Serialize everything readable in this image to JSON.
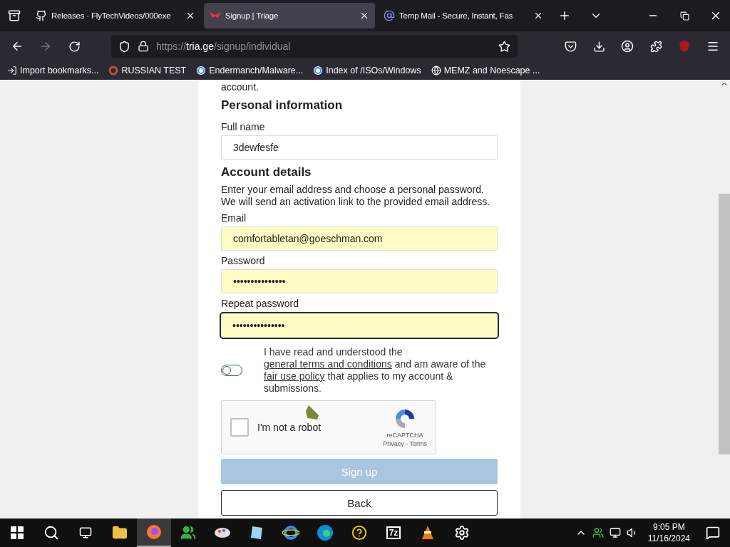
{
  "tabs": [
    {
      "title": "Releases · FlyTechVideos/000exe",
      "selected": false
    },
    {
      "title": "Signup | Triage",
      "selected": true
    },
    {
      "title": "Temp Mail - Secure, Instant, Fas",
      "selected": false
    }
  ],
  "address": {
    "prefix": "https://",
    "host": "tria.ge",
    "path": "/signup/individual"
  },
  "bookmarks": [
    {
      "label": "Import bookmarks..."
    },
    {
      "label": "RUSSIAN TEST"
    },
    {
      "label": "Endermanch/Malware..."
    },
    {
      "label": "Index of /ISOs/Windows"
    },
    {
      "label": "MEMZ and Noescape ..."
    }
  ],
  "form": {
    "intro_tail": "account.",
    "sections": [
      {
        "heading": "Personal information",
        "fields": [
          {
            "label": "Full name",
            "value": "3dewfesfe",
            "autofilled": false,
            "focused": false
          }
        ]
      },
      {
        "heading": "Account details",
        "description": "Enter your email address and choose a personal password. We will send an activation link to the provided email address.",
        "fields": [
          {
            "label": "Email",
            "value": "comfortabletan@goeschman.com",
            "autofilled": true,
            "focused": false
          },
          {
            "label": "Password",
            "value": "•••••••••••••••",
            "autofilled": true,
            "focused": false
          },
          {
            "label": "Repeat password",
            "value": "•••••••••••••••",
            "autofilled": true,
            "focused": true
          }
        ]
      }
    ],
    "terms": {
      "on": false,
      "parts": [
        {
          "text": "I have read and understood the ",
          "link": false
        },
        {
          "text": "general terms and conditions",
          "link": true
        },
        {
          "text": " and am aware of the ",
          "link": false
        },
        {
          "text": "fair use policy",
          "link": true
        },
        {
          "text": " that applies to my account & submissions.",
          "link": false
        }
      ]
    },
    "captcha": {
      "label": "I'm not a robot",
      "checked": false,
      "brand": "reCAPTCHA",
      "links": "Privacy - Terms"
    },
    "submit": {
      "label": "Sign up",
      "disabled": true
    },
    "back": {
      "label": "Back"
    }
  },
  "taskbar": {
    "apps": [
      {
        "active": false
      },
      {
        "active": true
      },
      {
        "active": false
      },
      {
        "active": false
      },
      {
        "active": false
      },
      {
        "active": false
      },
      {
        "active": false
      },
      {
        "active": false
      },
      {
        "label": "7z",
        "active": false
      },
      {
        "active": false
      },
      {
        "active": false
      }
    ],
    "time": "9:05 PM",
    "date": "11/16/2024"
  }
}
